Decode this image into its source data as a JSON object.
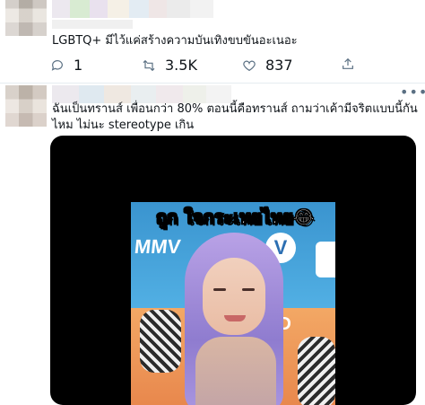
{
  "tweet1": {
    "text": "LGBTQ+ มีไว้แค่สร้างความบันเทิงขบขันอะเนอะ",
    "reply_count": "1",
    "retweet_count": "3.5K",
    "like_count": "837",
    "icons": {
      "reply": "comment-icon",
      "retweet": "retweet-icon",
      "like": "heart-icon",
      "share": "share-icon"
    }
  },
  "tweet2": {
    "text": "ฉันเป็นทรานส์ เพื่อนกว่า 80% ตอนนี้คือทรานส์ ถามว่าเค้ามีจริตแบบนี้กันไหม ไม่นะ stereotype เกิน",
    "more_icon": "more-dots-icon",
    "video_caption": "ถูก ใจกระเทยไทย😂"
  },
  "colors": {
    "icon_gray": "#5b7083",
    "divider": "#e6ecf0",
    "text": "#0f1419"
  }
}
